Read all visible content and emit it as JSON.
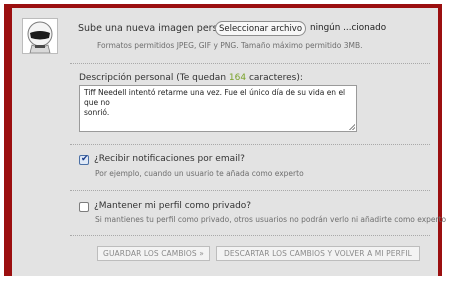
{
  "avatar": {
    "icon": "stig-helmet-avatar"
  },
  "upload": {
    "label": "Sube una nueva imagen personal",
    "button_label": "Seleccionar archivo",
    "file_status": "ningún ...cionado",
    "hint": "Formatos permitidos JPEG, GIF y PNG. Tamaño máximo permitido 3MB."
  },
  "description": {
    "label_prefix": "Descripción personal (Te quedan ",
    "remaining": "164",
    "label_suffix": " caracteres):",
    "value_line1": "Tiff Needell intentó retarme una vez. Fue el único día de su vida en el que no",
    "value_line2": "sonrió."
  },
  "notifications": {
    "checked": true,
    "label": "¿Recibir notificaciones por email?",
    "hint": "Por ejemplo, cuando un usuario te añada como experto"
  },
  "private_profile": {
    "checked": false,
    "label": "¿Mantener mi perfil como privado?",
    "hint": "Si mantienes tu perfil como privado, otros usuarios no podrán verlo ni añadirte como experto"
  },
  "actions": {
    "save_label": "GUARDAR LOS CAMBIOS »",
    "discard_label": "DESCARTAR LOS CAMBIOS Y VOLVER A MI PERFIL"
  },
  "colors": {
    "frame": "#9b0f10",
    "panel": "#e3e3e3",
    "counter": "#79a22a"
  }
}
